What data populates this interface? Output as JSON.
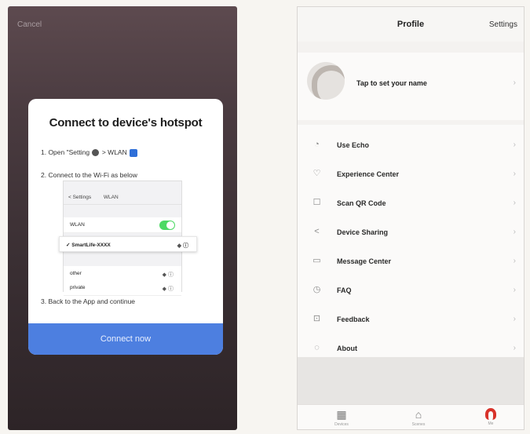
{
  "left_screen": {
    "cancel": "Cancel",
    "dialog_title": "Connect  to device's hotspot",
    "step1": "1. Open \"Setting",
    "step1_tail": "> WLAN",
    "step2": "2. Connect to the Wi-Fi as below",
    "step3": "3. Back to the App and continue",
    "wifi_header": "",
    "wifi_nav_back": "< Settings",
    "wifi_nav_title": "WLAN",
    "wifi_toggle_label": "WLAN",
    "wifi_selected_network": "✓  SmartLife-XXXX",
    "wifi_other_1": "other",
    "wifi_other_2": "private",
    "connect_button": "Connect now"
  },
  "right_screen": {
    "title": "Profile",
    "settings": "Settings",
    "profile_prompt": "Tap to set your name",
    "menu": [
      {
        "label": "Use Echo",
        "icon": "echo-icon"
      },
      {
        "label": "Experience Center",
        "icon": "heart-icon"
      },
      {
        "label": "Scan QR Code",
        "icon": "scan-icon"
      },
      {
        "label": "Device Sharing",
        "icon": "share-icon"
      },
      {
        "label": "Message Center",
        "icon": "message-icon"
      },
      {
        "label": "FAQ",
        "icon": "faq-icon"
      },
      {
        "label": "Feedback",
        "icon": "feedback-icon"
      },
      {
        "label": "About",
        "icon": "about-icon"
      }
    ],
    "tabs": [
      {
        "label": "Devices",
        "icon": "grid-icon"
      },
      {
        "label": "Scenes",
        "icon": "house-icon"
      },
      {
        "label": "Me",
        "icon": "me-icon"
      }
    ]
  },
  "colors": {
    "accent_blue": "#4d7fe0",
    "accent_red": "#d8322a",
    "toggle_green": "#4cd964"
  }
}
